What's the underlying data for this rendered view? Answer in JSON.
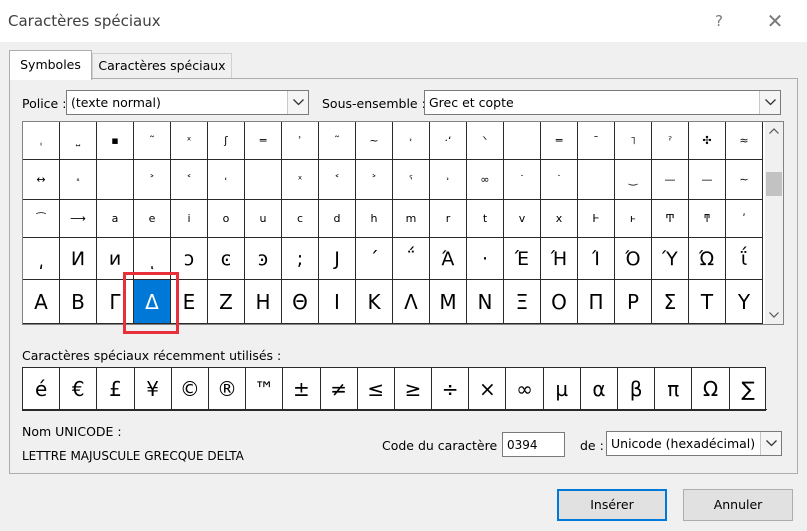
{
  "window": {
    "title": "Caractères spéciaux",
    "help": "?",
    "close": "✕"
  },
  "tabs": [
    {
      "label": "Symboles"
    },
    {
      "label": "Caractères spéciaux"
    }
  ],
  "font": {
    "label": "Police :",
    "value": "(texte normal)"
  },
  "subset": {
    "label": "Sous-ensemble :",
    "value": "Grec et copte"
  },
  "symbols": {
    "rows": [
      [
        "¸",
        "˛",
        "˜",
        "ˆ",
        "ˣ",
        "ʃ",
        "═",
        "ʾ",
        "˔",
        "˜",
        "˒",
        "˒",
        "ˉ",
        "˳",
        "ˌ",
        "˥",
        "¸",
        "ʼ",
        "˔",
        "≈"
      ],
      [
        "˽",
        "˖",
        "˔",
        "˃",
        "˂",
        "˓",
        "˂",
        "˃",
        "˃",
        "˙",
        "˂",
        "˙",
        "∞",
        "ˠ",
        "ʃ",
        "˺",
        "︶",
        "—",
        "—",
        "∼"
      ],
      [
        "↔",
        "͡",
        "a",
        "e",
        "i",
        "o",
        "u",
        "c",
        "d",
        "h",
        "m",
        "r",
        "t",
        "v",
        "x",
        "͜",
        "Ͱ",
        "ͱ",
        "Ͳ",
        "ͳ"
      ],
      [
        "ʹ",
        "͵",
        "Ͷ",
        "ͷ",
        "ͺ",
        "ͻ",
        "ͼ",
        "ͽ",
        ";",
        "Ϳ",
        "΄",
        "΅",
        "Ά",
        "·",
        "Έ",
        "Ή",
        "Ί",
        "Ό",
        "Ύ",
        "Ώ"
      ],
      [
        "ΐ",
        "Α",
        "Β",
        "Γ",
        "Δ",
        "Ε",
        "Ζ",
        "Η",
        "Θ",
        "Ι",
        "Κ",
        "Λ",
        "Μ",
        "Ν",
        "Ξ",
        "Ο",
        "Π",
        "Ρ",
        "Σ",
        "Τ"
      ]
    ],
    "display_rows": [
      [
        "¸",
        "˛",
        "▫",
        "˜",
        "ˣ",
        "ʃ",
        "═",
        "ʾ",
        "˔",
        "~",
        "˒",
        "‧‧",
        "ᐠ",
        "",
        "",
        "",
        "",
        "˒",
        "˔",
        "≈"
      ],
      [
        "ˌ",
        "˽",
        "▪",
        "˜",
        "",
        "",
        "",
        "",
        "",
        "",
        "˒",
        "ˌ",
        "˔",
        "",
        "═",
        "ˉ",
        "˥",
        "˓",
        "˖",
        ""
      ],
      [
        "↔",
        "˔",
        "a",
        "e",
        "i",
        "o",
        "u",
        "c",
        "d",
        "h",
        "m",
        "r",
        "t",
        "v",
        "x",
        "‿",
        "—",
        "",
        "—",
        "∼"
      ],
      [
        "͡",
        "⟶",
        "a",
        "e",
        "i",
        "o",
        "u",
        "c",
        "d",
        "h",
        "m",
        "r",
        "t",
        "v",
        "x",
        "Ͱ",
        "ͱ",
        "Ͳ",
        "ͳ",
        "ʹ"
      ],
      [
        "͵",
        "Ͷ",
        "ͷ",
        "ͺ",
        "ͻ",
        "ͼ",
        "ͽ",
        ";",
        "Ϳ",
        "΄",
        "΅",
        "Ά",
        "·",
        "Έ",
        "Ή",
        "Ί",
        "Ό",
        "Ύ",
        "Ώ",
        "ΐ"
      ]
    ]
  },
  "grid": {
    "row0": [
      "",
      "",
      "",
      "",
      "ˣ",
      "ʃ",
      "═",
      "ʾ",
      "˜",
      "~",
      "˒",
      "‧ʻ",
      "ᐠ",
      "",
      "",
      "",
      "",
      "ˀ",
      "✣",
      "≈"
    ],
    "row1": [
      "ˌ",
      "˽",
      "▪",
      "˜",
      "",
      "",
      "",
      "",
      "",
      "",
      "",
      "ˌ",
      "˔",
      "",
      "═",
      "ˉ",
      "˥",
      "",
      "",
      ""
    ],
    "row2": [
      "",
      "",
      "",
      "˃",
      "˂",
      "˓",
      "",
      "",
      "",
      "˂",
      "",
      "",
      "",
      "",
      "",
      "",
      "",
      "",
      "",
      ""
    ],
    "row3": [
      "↔",
      "˔",
      "",
      "",
      "",
      "ˣ",
      "˂",
      "˃",
      "ˁ",
      "˒",
      "˒",
      "˙",
      "∞",
      "",
      "",
      "",
      "‿",
      "—",
      "—",
      "∼"
    ],
    "row4": [
      "͡",
      "",
      "a",
      "e",
      "i",
      "o",
      "u",
      "c",
      "d",
      "h",
      "m",
      "r",
      "t",
      "v",
      "x",
      "Ͱ",
      "ͱ",
      "Ͳ",
      "ͳ",
      "ʹ"
    ],
    "row5": [
      "⟶",
      "",
      "",
      "",
      "",
      "",
      "",
      "",
      "",
      "",
      "",
      "",
      "",
      "",
      "",
      "",
      "",
      "",
      "",
      ""
    ],
    "row6": [
      "͵",
      "Ͷ",
      "ͷ",
      "ͺ",
      "ͻ",
      "ͼ",
      "ͽ",
      ";",
      "Ϳ",
      "΄",
      "΅",
      "Ά",
      "·",
      "Έ",
      "Ή",
      "Ί",
      "Ό",
      "Ύ",
      "Ώ",
      "ΐ"
    ],
    "row7": [
      "Α",
      "Β",
      "Γ",
      "Δ",
      "Ε",
      "Ζ",
      "Η",
      "Θ",
      "Ι",
      "Κ",
      "Λ",
      "Μ",
      "Ν",
      "Ξ",
      "Ο",
      "Π",
      "Ρ",
      "Σ",
      "Τ",
      "Υ"
    ]
  },
  "recent": {
    "label": "Caractères spéciaux récemment utilisés :",
    "items": [
      "é",
      "€",
      "£",
      "¥",
      "©",
      "®",
      "™",
      "±",
      "≠",
      "≤",
      "≥",
      "÷",
      "×",
      "∞",
      "µ",
      "α",
      "β",
      "π",
      "Ω",
      "∑"
    ]
  },
  "unicode": {
    "label": "Nom UNICODE :",
    "name": "LETTRE MAJUSCULE GRECQUE DELTA"
  },
  "charcode": {
    "label": "Code du caractère :",
    "value": "0394"
  },
  "from": {
    "label": "de :",
    "value": "Unicode (hexadécimal)"
  },
  "buttons": {
    "insert": "Insérer",
    "cancel": "Annuler"
  }
}
